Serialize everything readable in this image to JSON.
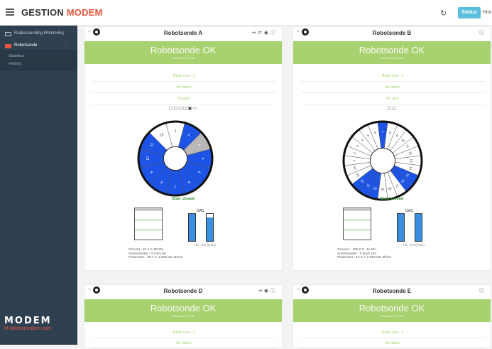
{
  "app": {
    "brand_main": "GESTION",
    "brand_accent": "MODEM"
  },
  "topbar": {
    "status_label": "Status",
    "hist_label": "Hist"
  },
  "sidebar": {
    "items": [
      {
        "label": "Radiosounding Monitoring"
      },
      {
        "label": "Robotsonde"
      }
    ],
    "sub_items": [
      {
        "label": "Statistics"
      },
      {
        "label": "Historic"
      }
    ],
    "logo_big": "MODEM",
    "logo_small": "M-Meteomodem.com"
  },
  "colors": {
    "blue": "#1d54e6",
    "gray": "#b8b8b8",
    "ok_green": "#a8d26f",
    "sidebar": "#2f4050"
  },
  "cards": [
    {
      "title": "Robotsonde A",
      "ok_text": "Robotsonde OK",
      "sub_text": "last launch : 00:00",
      "radio": "Radio loss : 3",
      "failure": "No failure",
      "alert": "No alert",
      "icons": "▢▢▢▢▣▭",
      "door": "Door closed",
      "gas_label": "GAS",
      "h2": "H2 : 0% (0.3C)",
      "info": [
        "Ground : 31.4 C 68.8%",
        "Anemometer : 0.7m/s 96",
        "Flowmeter : 36.7 C 1.025 bar 0l/min"
      ],
      "wheel": {
        "slots": 12,
        "labels": [
          "1",
          "2",
          "3",
          "4",
          "5",
          "6",
          "7",
          "8",
          "9",
          "10",
          "11",
          "12"
        ],
        "states": [
          "white",
          "blue",
          "gray",
          "blue",
          "blue",
          "blue",
          "blue",
          "blue",
          "blue",
          "blue",
          "blue",
          "white"
        ]
      }
    },
    {
      "title": "Robotsonde B",
      "ok_text": "Robotsonde OK",
      "sub_text": "last launch : 00:00",
      "radio": "Radio loss : 0",
      "failure": "No failure",
      "alert": "No alert",
      "icons": "▢▢",
      "door": "Door closed",
      "gas_label": "GAS",
      "h2": "H2 : 1% (0.8C)",
      "info": [
        "Ground : -150.0 C -11.0%",
        "Anemometer : 2.5m/s 197",
        "Flowmeter : 14.4 C 0.996 bar 0l/min"
      ],
      "wheel": {
        "slots": 24,
        "labels": [
          "7",
          "8",
          "9",
          "10",
          "11",
          "12",
          "13",
          "14",
          "15",
          "16",
          "17",
          "18",
          "19",
          "20",
          "21",
          "22",
          "23",
          "24",
          "1",
          "2",
          "3",
          "4",
          "5",
          "6"
        ],
        "states": [
          "blue",
          "white",
          "white",
          "white",
          "white",
          "white",
          "white",
          "white",
          "blue",
          "blue",
          "white",
          "white",
          "white",
          "blue",
          "blue",
          "blue",
          "white",
          "white",
          "white",
          "white",
          "white",
          "white",
          "white",
          "white"
        ]
      }
    },
    {
      "title": "Robotsonde D",
      "ok_text": "Robotsonde OK",
      "sub_text": "last launch : 00:00",
      "radio": "Radio loss : 3",
      "failure": "No failure"
    },
    {
      "title": "Robotsonde E",
      "ok_text": "Robotsonde OK",
      "sub_text": "last launch : 00:00",
      "radio": "Radio loss : 3",
      "failure": "No failure"
    }
  ],
  "gas_levels": {
    "A": [
      1.0,
      0.88
    ],
    "B": [
      1.0,
      1.0
    ]
  }
}
